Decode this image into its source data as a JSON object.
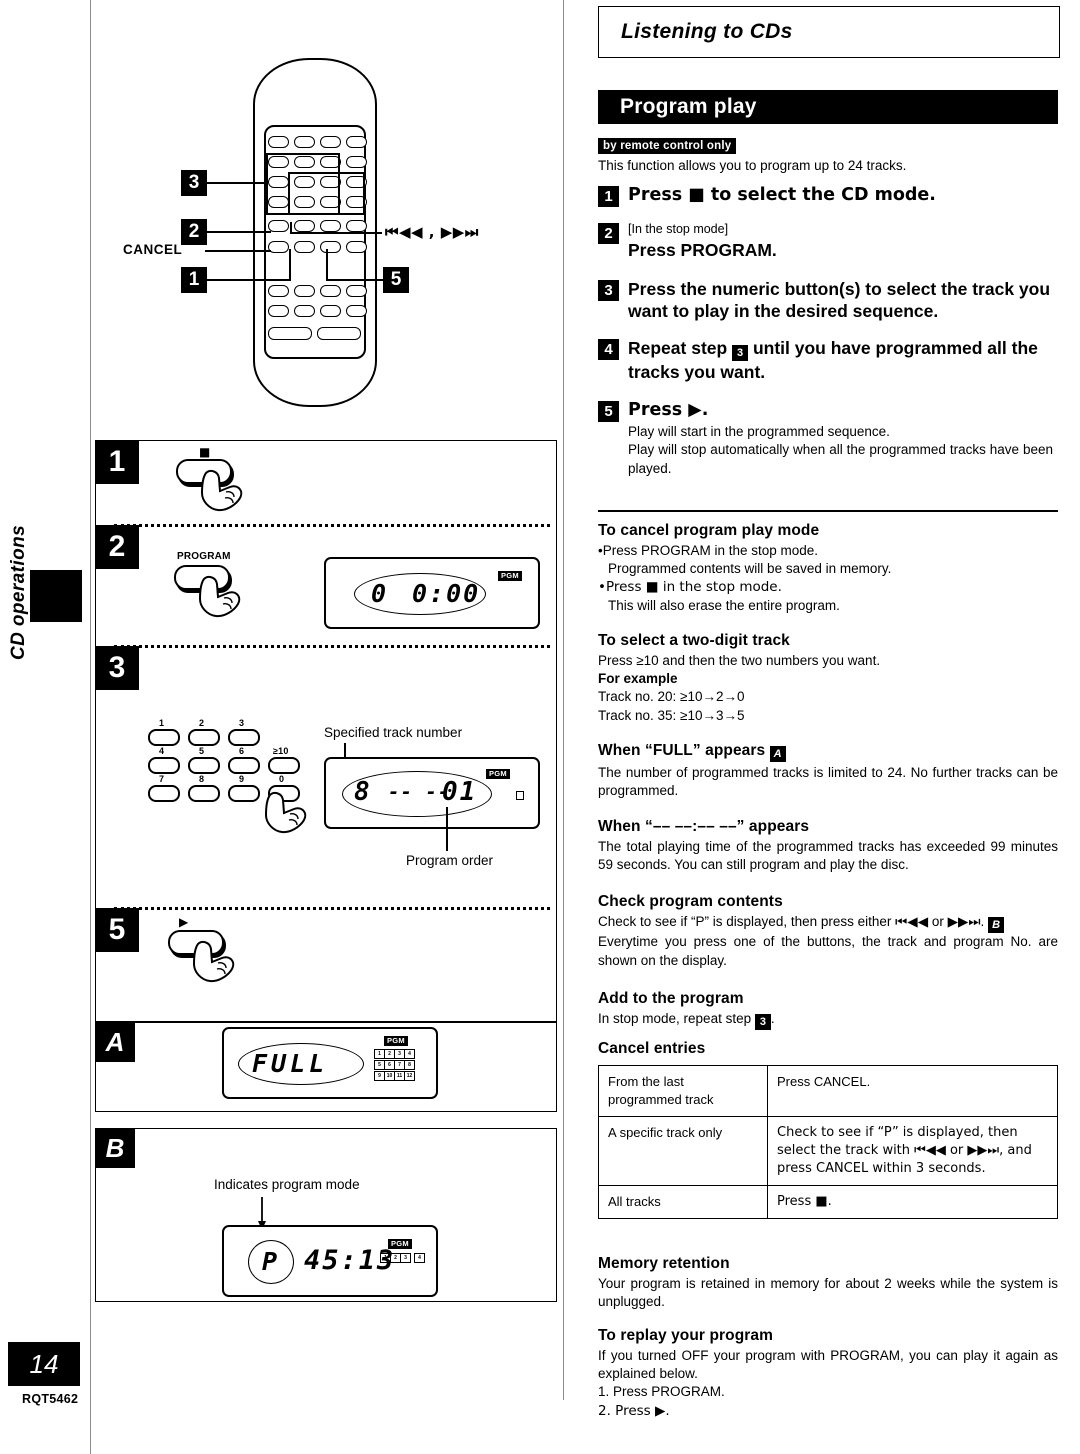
{
  "page": {
    "number": "14",
    "doc_code": "RQT5462",
    "margin_label": "CD operations"
  },
  "chapter": {
    "title": "Listening to CDs"
  },
  "section": {
    "title": "Program play",
    "badge": "by remote control only",
    "intro": "This function allows you to program up to 24 tracks."
  },
  "steps": [
    {
      "num": "1",
      "main": "Press ■ to select the CD mode.",
      "pre": "",
      "sub": []
    },
    {
      "num": "2",
      "pre": "[In the stop mode]",
      "main": "Press PROGRAM.",
      "sub": []
    },
    {
      "num": "3",
      "pre": "",
      "main": "Press the numeric button(s) to select the track you want to play in the desired sequence.",
      "sub": []
    },
    {
      "num": "4",
      "pre": "",
      "main_a": "Repeat step",
      "main_ref": "3",
      "main_b": "until you have programmed all the tracks you want.",
      "sub": []
    },
    {
      "num": "5",
      "pre": "",
      "main": "Press ▶.",
      "sub": [
        "Play will start in the programmed sequence.",
        "Play will stop automatically when all the programmed tracks have been played."
      ]
    }
  ],
  "sections": {
    "cancel_mode": {
      "heading": "To cancel program play mode",
      "bullets": [
        {
          "lead": "Press PROGRAM in the stop mode.",
          "cont": "Programmed contents will be saved in memory."
        },
        {
          "lead": "Press ■ in the stop mode.",
          "cont": "This will also erase the entire program."
        }
      ]
    },
    "two_digit": {
      "heading": "To select a two-digit track",
      "line1": "Press ≥10 and then the two numbers you want.",
      "example_heading": "For example",
      "examples": [
        "Track no. 20:  ≥10→2→0",
        "Track no. 35:  ≥10→3→5"
      ]
    },
    "full_appears": {
      "heading_a": "When “FULL” appears",
      "heading_ref": "A",
      "body": "The number of programmed tracks is limited to 24. No further tracks can be programmed."
    },
    "dashes_appear": {
      "heading": "When “–– ––:–– ––” appears",
      "body": "The total playing time of the programmed tracks has exceeded 99 minutes 59 seconds. You can still program and play the disc."
    },
    "check_contents": {
      "heading": "Check program contents",
      "line1_a": "Check to see if “P” is displayed, then press either",
      "line1_skip_back": "⏮◀◀",
      "line1_or": "or",
      "line1_skip_fwd": "▶▶⏭",
      "line1_ref": "B",
      "line2": "Everytime you press one of the buttons, the track and program No. are shown on the display."
    },
    "add_program": {
      "heading": "Add to the program",
      "line_a": "In stop mode, repeat step",
      "line_ref": "3",
      "line_b": "."
    },
    "cancel_entries": {
      "heading": "Cancel entries",
      "rows": [
        {
          "condition": "From the last programmed track",
          "action": "Press CANCEL."
        },
        {
          "condition": "A specific track only",
          "action": "Check to see if “P” is displayed, then select the track with ⏮◀◀ or ▶▶⏭, and press CANCEL within 3 seconds."
        },
        {
          "condition": "All tracks",
          "action": "Press ■."
        }
      ]
    },
    "memory_retention": {
      "heading": "Memory retention",
      "body": "Your program is retained in memory for about 2 weeks while the system is unplugged."
    },
    "replay": {
      "heading": "To replay your program",
      "body": "If you turned OFF your program with PROGRAM, you can play it again as explained below.",
      "items": [
        "1.  Press PROGRAM.",
        "2.  Press ▶."
      ]
    }
  },
  "remote_figure": {
    "callouts": [
      "1",
      "2",
      "3",
      "5"
    ],
    "cancel_label": "CANCEL",
    "skip_label": "⏮◀◀ , ▶▶⏭"
  },
  "illustrations": {
    "step1": {
      "badge": "1",
      "key_glyph": "■"
    },
    "step2": {
      "badge": "2",
      "key_label": "PROGRAM",
      "display": {
        "left_digit": "0",
        "time": "0:00",
        "pgm": "PGM"
      }
    },
    "step3": {
      "badge": "3",
      "keypad": [
        "1",
        "2",
        "3",
        "4",
        "5",
        "6",
        "≥10",
        "7",
        "8",
        "9",
        "0"
      ],
      "annotation_top": "Specified track number",
      "annotation_bottom": "Program order",
      "display": {
        "track": "8",
        "dashes": "-- --",
        "order": "01",
        "pgm": "PGM"
      }
    },
    "step5": {
      "badge": "5",
      "key_glyph": "▶"
    },
    "panelA": {
      "badge": "A",
      "display": {
        "text": "FULL",
        "pgm": "PGM",
        "matrix": [
          "1",
          "2",
          "3",
          "4",
          "5",
          "6",
          "7",
          "8",
          "9",
          "10",
          "11",
          "12"
        ]
      }
    },
    "panelB": {
      "badge": "B",
      "annotation": "Indicates program mode",
      "display": {
        "mode": "P",
        "time": "45:13",
        "pgm": "PGM",
        "matrix": [
          "1",
          "2",
          "3",
          "4"
        ]
      }
    }
  }
}
